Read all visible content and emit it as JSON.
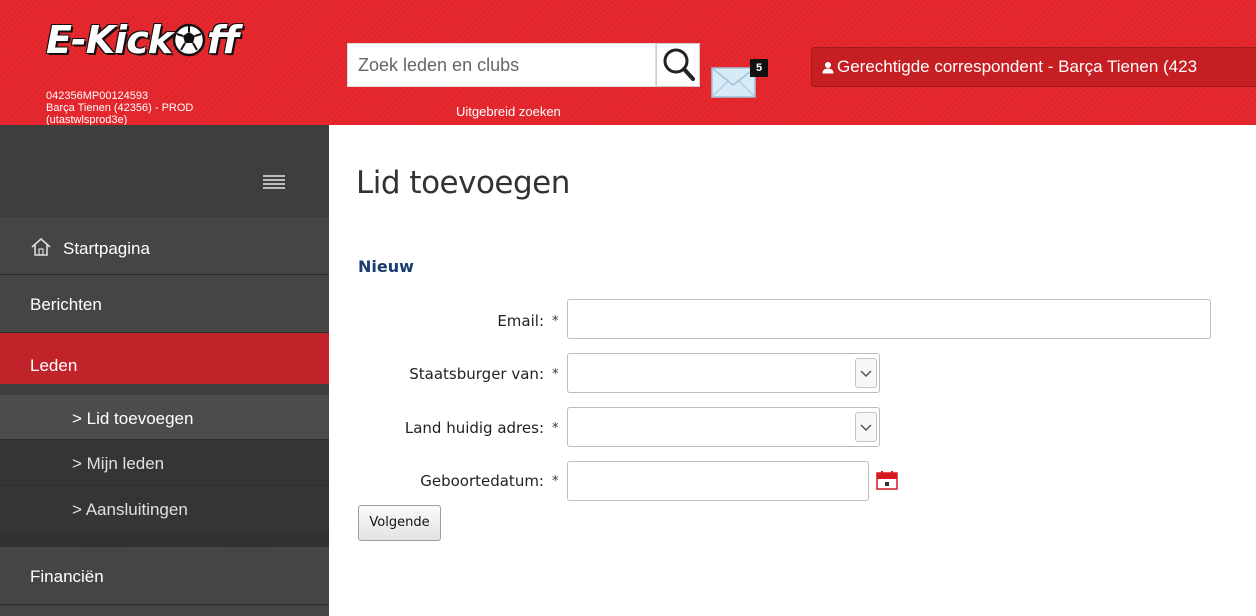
{
  "header": {
    "logo_text": "E-Kick0ff",
    "club_line_1": "042356MP00124593",
    "club_line_2": "Barça Tienen (42356) - PROD",
    "club_line_3": "(utastwlsprod3e)",
    "search_placeholder": "Zoek leden en clubs",
    "advanced_search_label": "Uitgebreid zoeken",
    "mail_count": "5",
    "user_button_label": "Gerechtigde correspondent - Barça Tienen (423",
    "accent_color": "#e3242b"
  },
  "sidebar": {
    "items": [
      {
        "label": "Startpagina",
        "icon": "home-icon"
      },
      {
        "label": "Berichten"
      },
      {
        "label": "Leden",
        "active": true
      },
      {
        "label": "Financiën"
      }
    ],
    "subitems": [
      {
        "label": "> Lid toevoegen",
        "active": true
      },
      {
        "label": "> Mijn leden"
      },
      {
        "label": "> Aansluitingen"
      }
    ],
    "active_color": "#c1232a"
  },
  "main": {
    "title": "Lid toevoegen",
    "section": "Nieuw",
    "fields": [
      {
        "label": "Email:",
        "required_mark": "*",
        "value": ""
      },
      {
        "label": "Staatsburger van:",
        "required_mark": "*",
        "value": ""
      },
      {
        "label": "Land huidig adres:",
        "required_mark": "*",
        "value": ""
      },
      {
        "label": "Geboortedatum:",
        "required_mark": "*",
        "value": ""
      }
    ],
    "next_button_label": "Volgende"
  }
}
